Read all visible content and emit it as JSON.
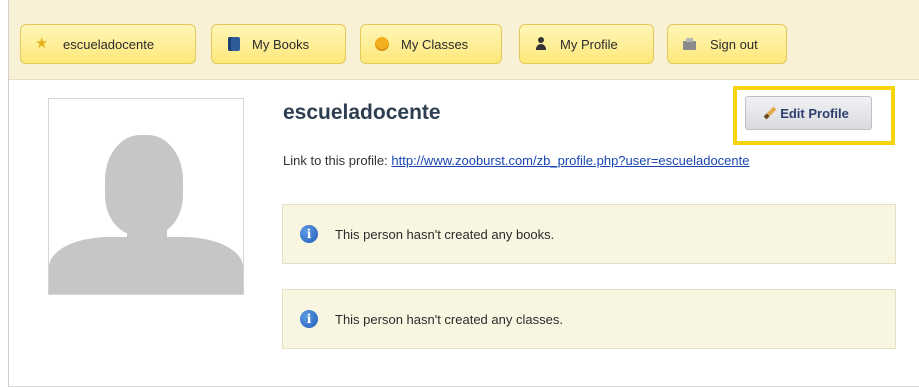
{
  "nav": {
    "items": [
      {
        "label": "escueladocente",
        "icon": "star-icon"
      },
      {
        "label": "My Books",
        "icon": "books-icon"
      },
      {
        "label": "My Classes",
        "icon": "smiley-icon"
      },
      {
        "label": "My Profile",
        "icon": "person-icon"
      },
      {
        "label": "Sign out",
        "icon": "signout-icon"
      }
    ]
  },
  "profile": {
    "name": "escueladocente",
    "link_label": "Link to this profile:",
    "link_url": "http://www.zooburst.com/zb_profile.php?user=escueladocente",
    "edit_label": "Edit Profile"
  },
  "notices": {
    "books": "This person hasn't created any books.",
    "classes": "This person hasn't created any classes."
  },
  "colors": {
    "highlight": "#f5d40a",
    "nav_bg": "#f8f1d6",
    "button_bg": "#fde87a",
    "name": "#2c3e50",
    "link": "#1a46b4"
  }
}
